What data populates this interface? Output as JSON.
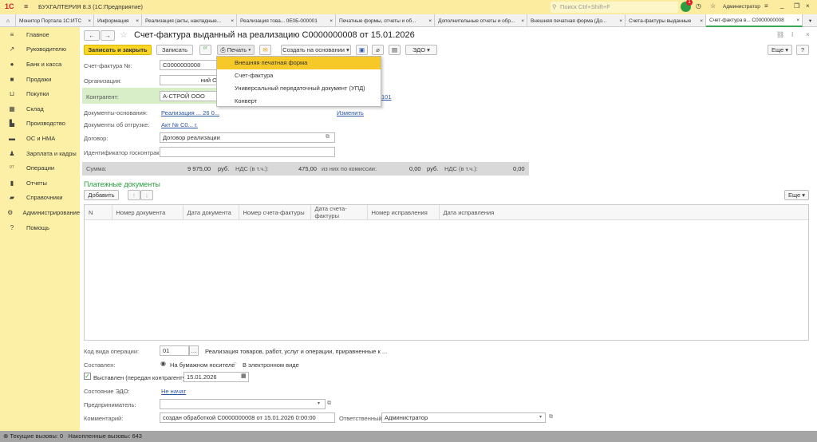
{
  "app": {
    "logo": "1С",
    "title": "БУХГАЛТЕРИЯ 8.3  (1С:Предприятие)",
    "search_placeholder": "Поиск Ctrl+Shift+F",
    "notifications": "1",
    "user": "Администратор"
  },
  "tabs": [
    {
      "label": "Монитор Портала 1С:ИТС"
    },
    {
      "label": "Информация"
    },
    {
      "label": "Реализация (акты, накладные..."
    },
    {
      "label": "Реализация това... 0Е0Б-000001"
    },
    {
      "label": "Печатные формы, отчеты и об..."
    },
    {
      "label": "Дополнительные отчеты и обр..."
    },
    {
      "label": "Внешняя печатная форма (До..."
    },
    {
      "label": "Счета-фактуры выданные"
    },
    {
      "label": "Счет-фактура в...  С0000000008",
      "active": true
    }
  ],
  "sidebar": {
    "items": [
      {
        "icon": "menu-icon",
        "label": "Главное"
      },
      {
        "icon": "chart-up-icon",
        "label": "Руководителю"
      },
      {
        "icon": "ruble-icon",
        "label": "Банк и касса"
      },
      {
        "icon": "bag-icon",
        "label": "Продажи"
      },
      {
        "icon": "cart-icon",
        "label": "Покупки"
      },
      {
        "icon": "warehouse-icon",
        "label": "Склад"
      },
      {
        "icon": "factory-icon",
        "label": "Производство"
      },
      {
        "icon": "truck-icon",
        "label": "ОС и НМА"
      },
      {
        "icon": "person-icon",
        "label": "Зарплата и кадры"
      },
      {
        "icon": "dt-kt-icon",
        "label": "Операции"
      },
      {
        "icon": "bar-chart-icon",
        "label": "Отчеты"
      },
      {
        "icon": "book-icon",
        "label": "Справочники"
      },
      {
        "icon": "gear-icon",
        "label": "Администрирование"
      },
      {
        "icon": "help-icon",
        "label": "Помощь"
      }
    ]
  },
  "doc": {
    "title": "Счет-фактура выданный на реализацию С0000000008 от 15.01.2026"
  },
  "toolbar": {
    "save_close": "Записать и закрыть",
    "save": "Записать",
    "print": "Печать",
    "create_based": "Создать на основании",
    "edo": "ЭДО",
    "more": "Еще",
    "help": "?"
  },
  "print_menu": {
    "items": [
      "Внешняя печатная форма",
      "Счет-фактура",
      "Универсальный передаточный документ (УПД)",
      "Конверт"
    ]
  },
  "form": {
    "number_label": "Счет-фактура №:",
    "number": "С0000000008",
    "org_label": "Организация:",
    "org": "ний О",
    "counterparty_label": "Контрагент:",
    "counterparty": "А-СТРОЙ ООО",
    "counterparty_link": "101",
    "basis_label": "Документы-основания:",
    "basis": "Реализация ... 26 0...",
    "change": "Изменить",
    "shipment_label": "Документы об отгрузке:",
    "shipment": "Акт № С0... г.",
    "contract_label": "Договор:",
    "contract": "Договор реализации",
    "gov_label": "Идентификатор госконтракта:",
    "gov": ""
  },
  "totals": {
    "sum_label": "Сумма:",
    "sum": "9 975,00",
    "cur": "руб.",
    "vat_label": "НДС (в т.ч.):",
    "vat": "475,00",
    "comm_label": "из них по комиссии:",
    "comm": "0,00",
    "cur2": "руб.",
    "vat2_label": "НДС (в т.ч.):",
    "vat2": "0,00"
  },
  "payments": {
    "title": "Платежные документы",
    "add": "Добавить",
    "more": "Еще",
    "columns": [
      "N",
      "Номер документа",
      "Дата документа",
      "Номер счета-фактуры",
      "Дата счета-фактуры",
      "Номер исправления",
      "Дата исправления"
    ]
  },
  "bottom": {
    "op_label": "Код вида операции:",
    "op": "01",
    "op_desc": "Реализация товаров, работ, услуг и операции, приравненные к ...",
    "made_label": "Составлен:",
    "paper": "На бумажном носителе",
    "electronic": "В электронном виде",
    "issued_label": "Выставлен (передан контрагенту):",
    "issued_date": "15.01.2026",
    "edo_label": "Состояние ЭДО:",
    "edo": "Не начат",
    "entrepreneur_label": "Предприниматель:",
    "entrepreneur": "",
    "comment_label": "Комментарий:",
    "comment": "создан обработкой С0000000008 от 15.01.2026 0:00:00",
    "resp_label": "Ответственный:",
    "resp": "Администратор"
  },
  "status": {
    "current": "Текущие вызовы: 0",
    "accum": "Накопленные вызовы: 643"
  }
}
